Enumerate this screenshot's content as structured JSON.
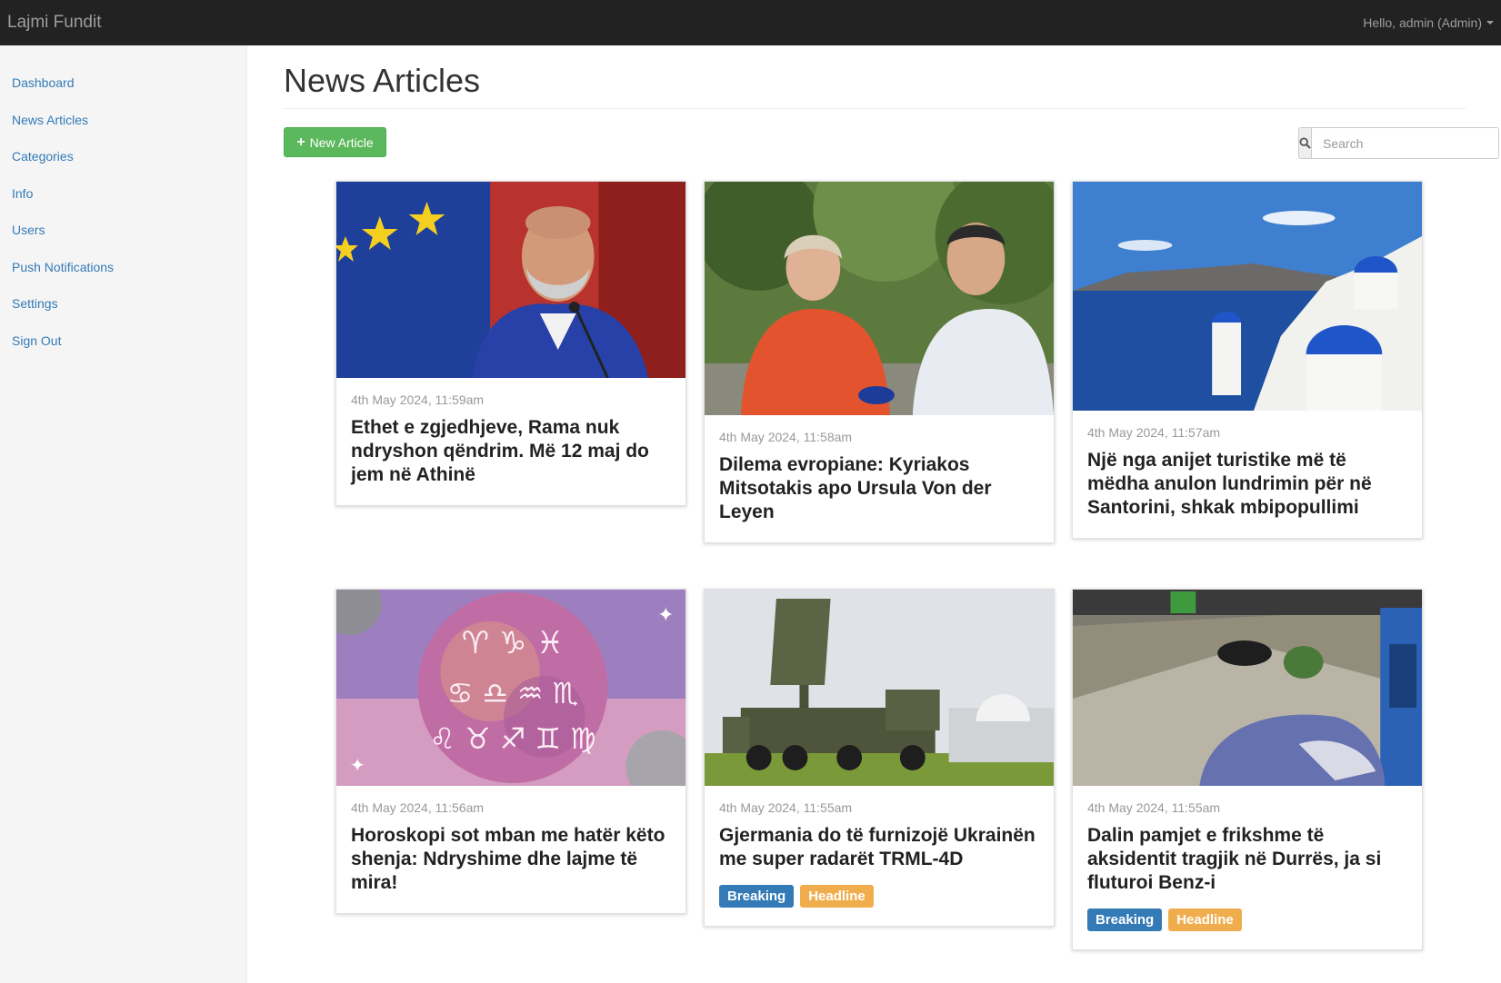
{
  "app": {
    "brand": "Lajmi Fundit",
    "user_greeting": "Hello, admin (Admin)"
  },
  "sidebar": {
    "items": [
      {
        "label": "Dashboard"
      },
      {
        "label": "News Articles"
      },
      {
        "label": "Categories"
      },
      {
        "label": "Info"
      },
      {
        "label": "Users"
      },
      {
        "label": "Push Notifications"
      },
      {
        "label": "Settings"
      },
      {
        "label": "Sign Out"
      }
    ]
  },
  "main": {
    "title": "News Articles",
    "new_button_label": "New Article",
    "search_placeholder": "Search"
  },
  "articles": [
    {
      "date": "4th May 2024, 11:59am",
      "title": "Ethet e zgjedhjeve, Rama nuk ndryshon qëndrim. Më 12 maj do jem në Athinë",
      "tags": []
    },
    {
      "date": "4th May 2024, 11:58am",
      "title": "Dilema evropiane: Kyriakos Mitsotakis apo Ursula Von der Leyen",
      "tags": []
    },
    {
      "date": "4th May 2024, 11:57am",
      "title": "Një nga anijet turistike më të mëdha anulon lundrimin për në Santorini, shkak mbipopullimi",
      "tags": []
    },
    {
      "date": "4th May 2024, 11:56am",
      "title": "Horoskopi sot mban me hatër këto shenja: Ndryshime dhe lajme të mira!",
      "tags": []
    },
    {
      "date": "4th May 2024, 11:55am",
      "title": "Gjermania do të furnizojë Ukrainën me super radarët TRML-4D",
      "tags": [
        "Breaking",
        "Headline"
      ]
    },
    {
      "date": "4th May 2024, 11:55am",
      "title": "Dalin pamjet e frikshme të aksidentit tragjik në Durrës, ja si fluturoi Benz-i",
      "tags": [
        "Breaking",
        "Headline"
      ]
    }
  ],
  "colors": {
    "navbar": "#222222",
    "link": "#337ab7",
    "success": "#5cb85c",
    "breaking": "#337ab7",
    "headline": "#f0ad4e"
  }
}
